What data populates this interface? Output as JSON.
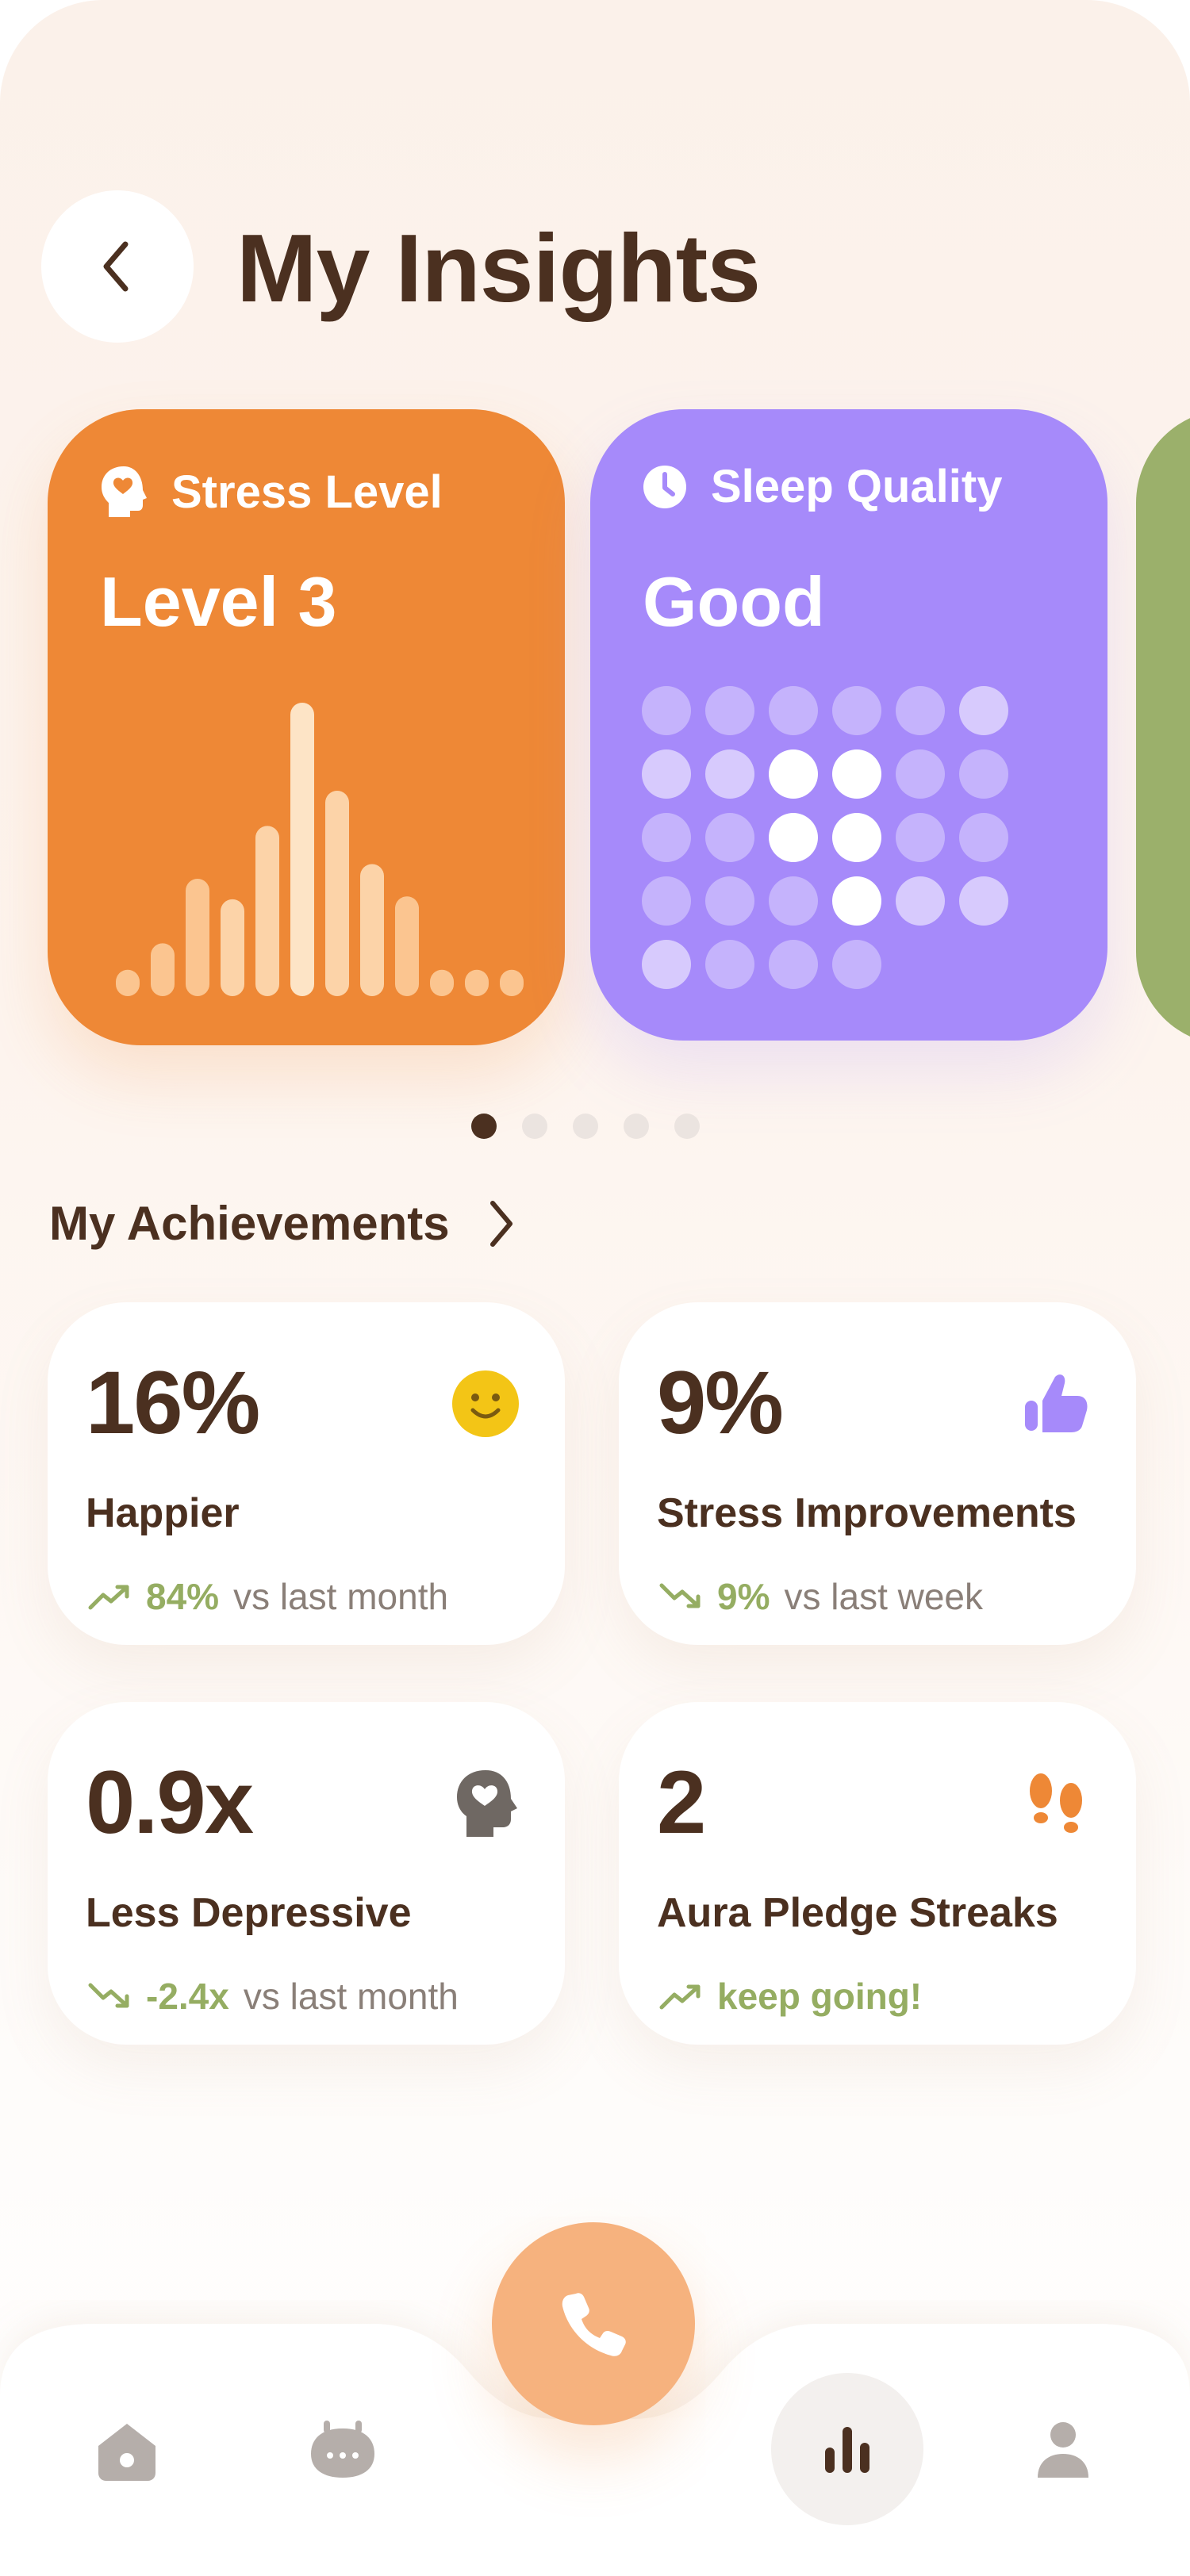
{
  "header": {
    "title": "My Insights"
  },
  "cards": [
    {
      "title": "Stress Level",
      "value": "Level 3",
      "icon": "head-heart-icon",
      "color": "#ee8836",
      "bars": [
        0.09,
        0.18,
        0.4,
        0.33,
        0.58,
        1.0,
        0.7,
        0.45,
        0.34,
        0.09,
        0.09,
        0.09
      ]
    },
    {
      "title": "Sleep Quality",
      "value": "Good",
      "icon": "clock-icon",
      "color": "#a68afa",
      "grid": [
        [
          0.35,
          0.35,
          0.35,
          0.35,
          0.35,
          0.55
        ],
        [
          0.55,
          0.55,
          1,
          1,
          0.35,
          0.35
        ],
        [
          0.35,
          0.35,
          1,
          1,
          0.35,
          0.35
        ],
        [
          0.35,
          0.35,
          0.35,
          1,
          0.55,
          0.55
        ],
        [
          0.55,
          0.35,
          0.35,
          0.35
        ]
      ]
    },
    {
      "color": "#9bb06b"
    }
  ],
  "pager": {
    "count": 5,
    "active": 0
  },
  "achievements": {
    "title": "My Achievements",
    "items": [
      {
        "value": "16%",
        "label": "Happier",
        "trend_value": "84%",
        "trend_text": "vs last month",
        "trend": "up",
        "icon": "smiley-icon"
      },
      {
        "value": "9%",
        "label": "Stress Improvements",
        "trend_value": "9%",
        "trend_text": "vs last week",
        "trend": "down",
        "icon": "thumbs-up-icon"
      },
      {
        "value": "0.9x",
        "label": "Less Depressive",
        "trend_value": "-2.4x",
        "trend_text": "vs last month",
        "trend": "down",
        "icon": "head-heart-icon"
      },
      {
        "value": "2",
        "label": "Aura Pledge Streaks",
        "trend_value": "keep going!",
        "trend_text": "",
        "trend": "up",
        "icon": "footprints-icon"
      }
    ]
  },
  "nav": {
    "items": [
      "home-icon",
      "robot-icon",
      "call-icon",
      "chart-icon",
      "profile-icon"
    ],
    "active": "chart-icon"
  }
}
